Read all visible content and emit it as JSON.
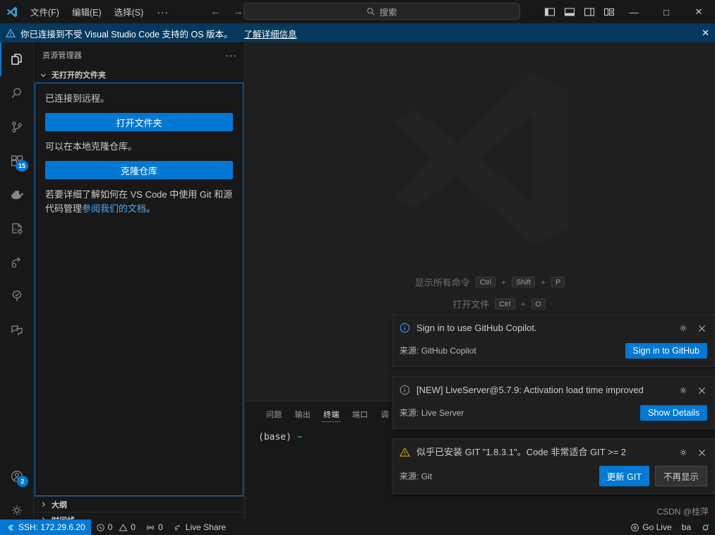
{
  "titlebar": {
    "logo_icon": "vscode-logo-icon",
    "menus": [
      "文件(F)",
      "编辑(E)",
      "选择(S)"
    ],
    "overflow_label": "···",
    "nav_back_icon": "arrow-left-icon",
    "nav_forward_icon": "arrow-forward-icon",
    "search_placeholder": "搜索",
    "search_icon": "search-icon",
    "layout_buttons": [
      {
        "name": "toggle-primary-sidebar",
        "icon": "layout-sidebar-left-icon"
      },
      {
        "name": "toggle-panel",
        "icon": "layout-panel-icon"
      },
      {
        "name": "toggle-secondary-sidebar",
        "icon": "layout-sidebar-right-icon"
      },
      {
        "name": "customize-layout",
        "icon": "layout-customize-icon"
      }
    ],
    "window_minimize": "—",
    "window_maximize": "□",
    "window_close": "✕"
  },
  "banner": {
    "warning_icon": "warning-triangle-icon",
    "text": "你已连接到不受 Visual Studio Code 支持的 OS 版本。",
    "link": "了解详细信息",
    "close": "✕"
  },
  "activitybar": {
    "items": [
      {
        "name": "sidebar-item-explorer",
        "icon": "files-icon",
        "active": true,
        "badge": ""
      },
      {
        "name": "sidebar-item-search",
        "icon": "search-icon",
        "active": false,
        "badge": ""
      },
      {
        "name": "sidebar-item-source-control",
        "icon": "source-control-icon",
        "active": false,
        "badge": ""
      },
      {
        "name": "sidebar-item-extensions",
        "icon": "extensions-icon",
        "active": false,
        "badge": "15"
      },
      {
        "name": "sidebar-item-docker",
        "icon": "docker-icon",
        "active": false,
        "badge": ""
      },
      {
        "name": "sidebar-item-cpp-config",
        "icon": "cpp-config-icon",
        "active": false,
        "badge": ""
      },
      {
        "name": "sidebar-item-live-share",
        "icon": "live-share-icon",
        "active": false,
        "badge": ""
      },
      {
        "name": "sidebar-item-testing",
        "icon": "testing-beaker-icon",
        "active": false,
        "badge": ""
      },
      {
        "name": "sidebar-item-chat",
        "icon": "chat-icon",
        "active": false,
        "badge": ""
      }
    ],
    "bottom_items": [
      {
        "name": "accounts-button",
        "icon": "account-icon",
        "badge": "2"
      },
      {
        "name": "manage-settings-button",
        "icon": "gear-icon",
        "badge": ""
      }
    ]
  },
  "sidebar": {
    "title": "资源管理器",
    "more_actions": "···",
    "section_title": "无打开的文件夹",
    "connected_text": "已连接到远程。",
    "open_folder_button": "打开文件夹",
    "clone_hint": "可以在本地克隆仓库。",
    "clone_repo_button": "克隆仓库",
    "git_help_prefix": "若要详细了解如何在 VS Code 中使用 Git 和源代码管理",
    "git_help_link": "参阅我们的文档",
    "git_help_suffix": "。",
    "outline_section": "大纲",
    "timeline_section": "时间线"
  },
  "editor": {
    "watermark_icon": "vscode-logo-watermark",
    "shortcuts": [
      {
        "label": "显示所有命令",
        "keys": [
          "Ctrl",
          "Shift",
          "P"
        ]
      },
      {
        "label": "打开文件",
        "keys": [
          "Ctrl",
          "O"
        ]
      }
    ],
    "key_sep": "+"
  },
  "panel": {
    "tabs": [
      {
        "label": "问题",
        "active": false
      },
      {
        "label": "输出",
        "active": false
      },
      {
        "label": "终端",
        "active": true
      },
      {
        "label": "端口",
        "active": false
      },
      {
        "label": "调",
        "active": false
      }
    ],
    "terminal_prompt": "(base)",
    "terminal_path": "~"
  },
  "notifications": [
    {
      "severity": "info",
      "icon": "info-circle-icon",
      "message": "Sign in to use GitHub Copilot.",
      "source_label": "来源:",
      "source": "GitHub Copilot",
      "buttons": [
        {
          "label": "Sign in to GitHub",
          "style": "primary"
        }
      ],
      "gear_icon": "gear-icon",
      "close_icon": "close-icon"
    },
    {
      "severity": "info",
      "icon": "info-circle-icon",
      "message": "[NEW] LiveServer@5.7.9: Activation load time improved",
      "source_label": "来源:",
      "source": "Live Server",
      "buttons": [
        {
          "label": "Show Details",
          "style": "primary"
        }
      ],
      "gear_icon": "gear-icon",
      "close_icon": "close-icon"
    },
    {
      "severity": "warning",
      "icon": "warning-triangle-icon",
      "message": "似乎已安装 GIT \"1.8.3.1\"。Code 非常适合 GIT >= 2",
      "source_label": "来源:",
      "source": "Git",
      "buttons": [
        {
          "label": "更新 GIT",
          "style": "primary"
        },
        {
          "label": "不再显示",
          "style": "secondary"
        }
      ],
      "gear_icon": "gear-icon",
      "close_icon": "close-icon"
    }
  ],
  "statusbar": {
    "remote_icon": "remote-indicator-icon",
    "remote_label": "SSH: 172.29.6.20",
    "errors_icon": "error-circle-icon",
    "errors_count": "0",
    "warnings_icon": "warning-triangle-icon",
    "warnings_count": "0",
    "ports_icon": "radio-tower-icon",
    "ports_count": "0",
    "live_share_icon": "live-share-icon",
    "live_share_label": "Live Share",
    "go_live_icon": "broadcast-icon",
    "go_live_label": "Go Live",
    "python_env": "ba",
    "bell_icon": "bell-dot-icon"
  },
  "watermark_text": "CSDN @桂萍",
  "colors": {
    "accent": "#0078d4",
    "banner_bg": "#04395e",
    "editor_bg": "#1f1f1f",
    "chrome_bg": "#181818",
    "border": "#2b2b2b",
    "link": "#4daafc",
    "warning": "#cca700",
    "terminal_green": "#23d18b"
  }
}
